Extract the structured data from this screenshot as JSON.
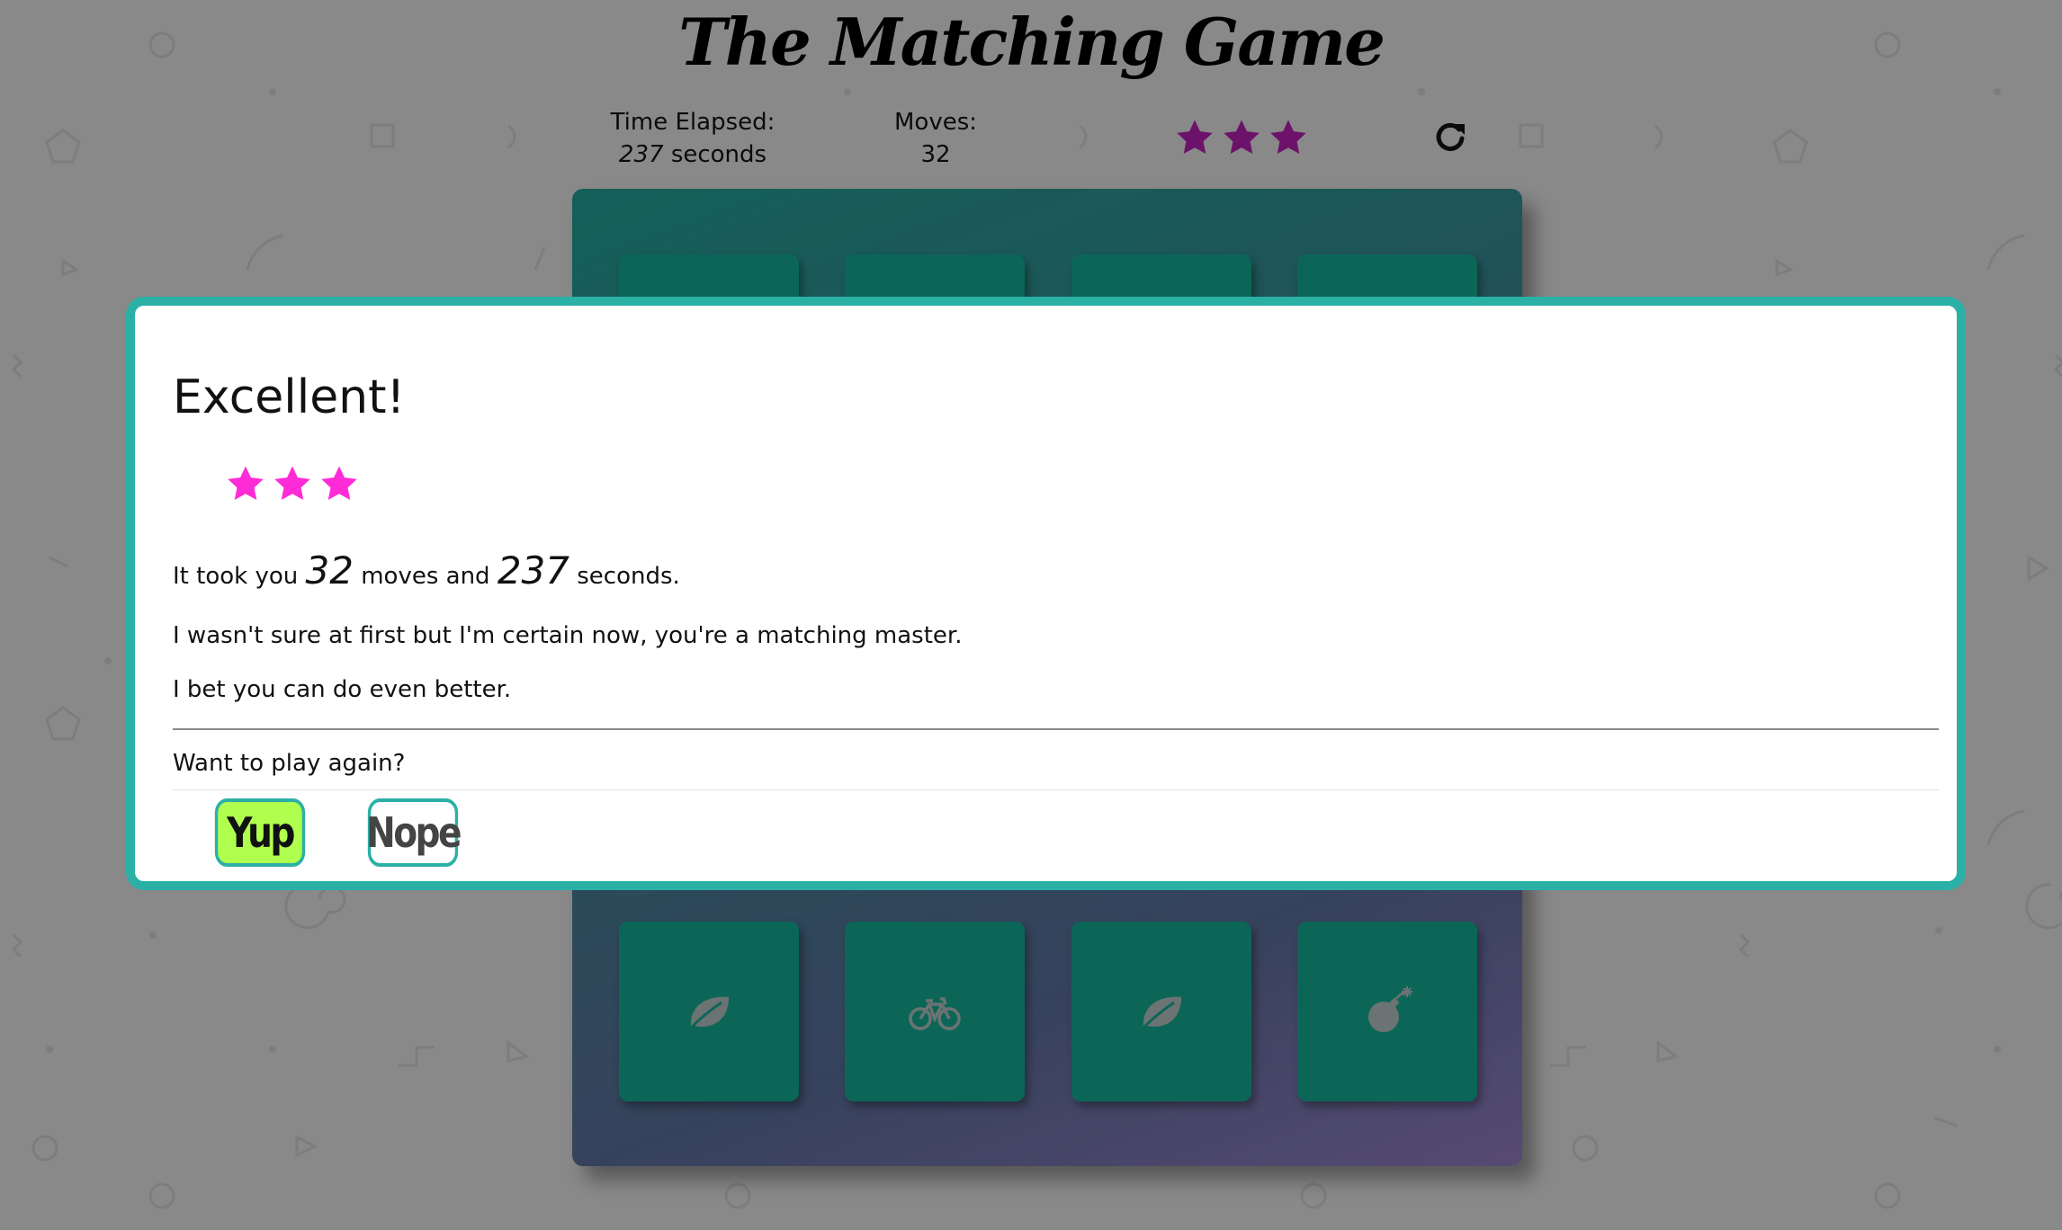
{
  "header": {
    "title": "The Matching Game"
  },
  "score_panel": {
    "time_label": "Time Elapsed:",
    "time_value": "237",
    "time_unit": "seconds",
    "moves_label": "Moves:",
    "moves_value": "32",
    "star_rating": 3,
    "star_color": "#9b1a98",
    "restart_icon": "restart-icon"
  },
  "deck": {
    "colors": {
      "card": "#12937f",
      "icon": "#9aa7a4"
    },
    "visible_cards": [
      {
        "icon": "leaf-icon"
      },
      {
        "icon": "bicycle-icon"
      },
      {
        "icon": "leaf-icon"
      },
      {
        "icon": "bomb-icon"
      }
    ]
  },
  "modal": {
    "title": "Excellent!",
    "star_rating": 3,
    "star_color": "#ff2bd6",
    "stats_prefix": "It took you",
    "moves": "32",
    "stats_middle": "moves and",
    "seconds": "237",
    "stats_suffix": "seconds.",
    "message_1": "I wasn't sure at first but I'm certain now, you're a matching master.",
    "message_2": "I bet you can do even better.",
    "play_again_prompt": "Want to play again?",
    "yes_button": "Yup",
    "no_button": "Nope",
    "border_color": "#2bb0a6",
    "yes_color": "#b0ff4f"
  }
}
